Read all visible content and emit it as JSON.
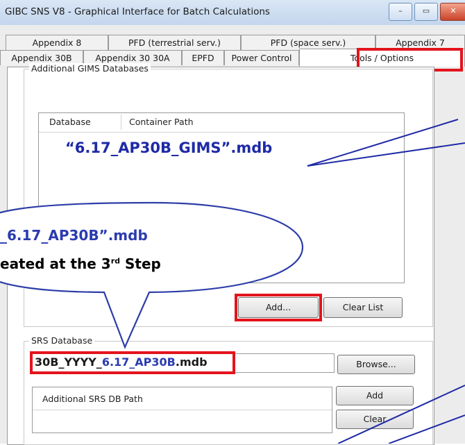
{
  "window": {
    "title": "GIBC SNS V8 - Graphical Interface for Batch Calculations",
    "controls": [
      "–",
      "▭",
      "✕"
    ]
  },
  "tabs_row1": [
    "Appendix 8",
    "PFD (terrestrial serv.)",
    "PFD (space serv.)",
    "Appendix 7"
  ],
  "tabs_row2": [
    "Appendix 30B",
    "Appendix 30 30A",
    "EPFD",
    "Power Control",
    "Tools / Options"
  ],
  "gims": {
    "legend": "Additional GIMS Databases",
    "col_database": "Database",
    "col_container": "Container Path",
    "entry": "“6.17_AP30B_GIMS”.mdb",
    "add_button": "Add...",
    "clear_button": "Clear List"
  },
  "srs": {
    "legend": "SRS Database",
    "value_prefix": "30B_YYYY_",
    "value_highlight": "6.17_AP30B",
    "value_suffix": ".mdb",
    "browse_button": "Browse...",
    "additional_header": "Additional SRS DB Path",
    "add_button": "Add",
    "clear_button": "Clear"
  },
  "callout": {
    "line1": "_6.17_AP30B”.mdb",
    "line2_main": "eated at the 3",
    "line2_sup": "rd",
    "line2_tail": " Step"
  },
  "colors": {
    "highlight_red": "#e3141d",
    "annotation_blue": "#1e2aa6"
  }
}
